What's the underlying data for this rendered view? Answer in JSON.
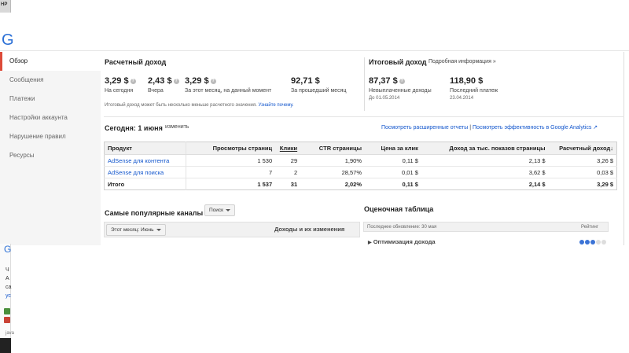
{
  "chrome": {
    "tab_label": "НР"
  },
  "sidebar": {
    "items": [
      {
        "label": "Обзор",
        "active": true
      },
      {
        "label": "Сообщения"
      },
      {
        "label": "Платежи"
      },
      {
        "label": "Настройки аккаунта"
      },
      {
        "label": "Нарушение правил"
      },
      {
        "label": "Ресурсы"
      }
    ]
  },
  "estimated": {
    "title": "Расчетный доход",
    "metrics": [
      {
        "value": "3,29 $",
        "label": "На сегодня"
      },
      {
        "value": "2,43 $",
        "label": "Вчера"
      },
      {
        "value": "3,29 $",
        "label": "За этот месяц, на данный момент"
      },
      {
        "value": "92,71 $",
        "label": "За прошедший месяц"
      }
    ],
    "note": "Итоговый доход может быть несколько меньше расчетного значения.",
    "note_link": "Узнайте почему."
  },
  "final": {
    "title": "Итоговый доход",
    "more_link": "Подробная информация »",
    "unpaid_value": "87,37 $",
    "unpaid_label": "Невыплаченные доходы",
    "unpaid_date": "До 01.05.2014",
    "last_value": "118,90 $",
    "last_label": "Последний платеж",
    "last_date": "23.04.2014"
  },
  "today": {
    "title": "Сегодня: 1 июня",
    "change_link": "изменить",
    "reports_link": "Посмотреть расширенные отчеты",
    "divider": "|",
    "analytics_link": "Посмотреть эффективность в Google Analytics"
  },
  "table": {
    "headers": [
      "Продукт",
      "Просмотры страниц",
      "Клики",
      "CTR страницы",
      "Цена за клик",
      "Доход за тыс. показов страницы",
      "Расчетный доход"
    ],
    "rows": [
      [
        "AdSense для контента",
        "1 530",
        "29",
        "1,90%",
        "0,11 $",
        "2,13 $",
        "3,26 $"
      ],
      [
        "AdSense для поиска",
        "7",
        "2",
        "28,57%",
        "0,01 $",
        "3,62 $",
        "0,03 $"
      ],
      [
        "Итого",
        "1 537",
        "31",
        "2,02%",
        "0,11 $",
        "2,14 $",
        "3,29 $"
      ]
    ]
  },
  "popular": {
    "title": "Самые популярные каналы",
    "dropdown": "Поиск",
    "month_filter": "Этот месяц: Июнь",
    "income_header": "Доходы и их изменения"
  },
  "scorecard": {
    "title": "Оценочная таблица",
    "updated": "Последнее обновление: 30 мая",
    "rating": "Рейтинг",
    "item": "Оптимизация дохода",
    "score": 3,
    "max_score": 5
  },
  "fragment": {
    "lines": [
      "Ч",
      "А",
      "са",
      "ус"
    ],
    "bottom": "java"
  },
  "colors": {
    "link": "#1155cc",
    "accent": "#dd4b39",
    "score_dot": "#3b73d6"
  }
}
